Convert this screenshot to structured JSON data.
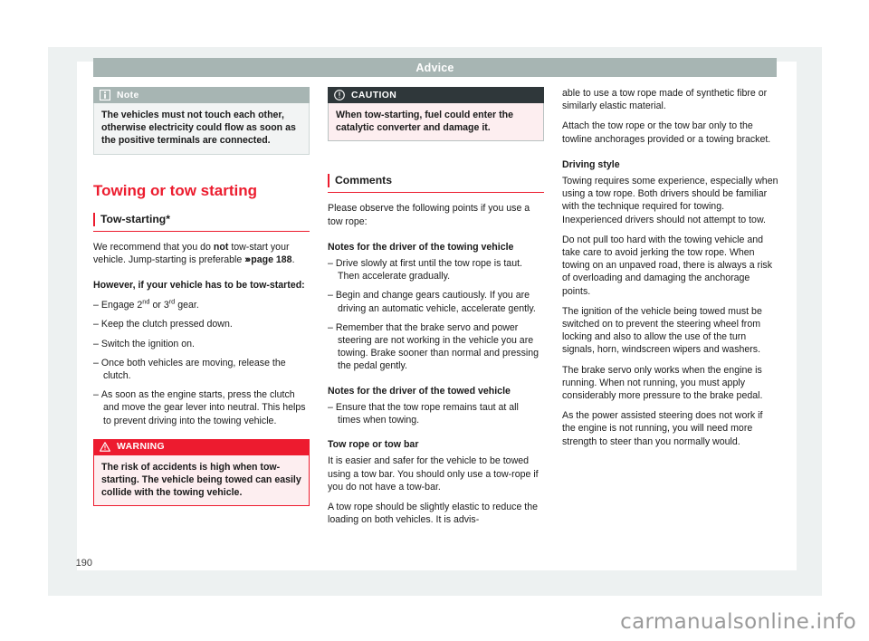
{
  "header": {
    "title": "Advice"
  },
  "folio": {
    "page_number": "190"
  },
  "watermark": {
    "text": "carmanualsonline.info"
  },
  "column_left": {
    "note_box": {
      "icon": "info-icon",
      "label": "Note",
      "text": "The vehicles must not touch each other, otherwise electricity could flow as soon as the positive terminals are connected."
    },
    "heading": "Towing or tow starting",
    "subheading": "Tow-starting*",
    "para_1_pre": "We recommend that you do ",
    "para_1_bold": "not",
    "para_1_post": " tow-start your vehicle. Jump-starting is preferable ",
    "para_1_ref_arrow": "›››",
    "para_1_ref": "page 188",
    "para_1_end": ".",
    "para_2": "However, if your vehicle has to be tow-started:",
    "list": [
      {
        "pre": "Engage 2",
        "sup1": "nd",
        "mid": " or 3",
        "sup2": "rd",
        "post": " gear."
      },
      {
        "pre": "Keep the clutch pressed down."
      },
      {
        "pre": "Switch the ignition on."
      },
      {
        "pre": "Once both vehicles are moving, release the clutch."
      },
      {
        "pre": "As soon as the engine starts, press the clutch and move the gear lever into neutral. This helps to prevent driving into the towing vehicle."
      }
    ],
    "warning_box": {
      "icon": "warning-triangle-icon",
      "label": "WARNING",
      "text": "The risk of accidents is high when tow-starting. The vehicle being towed can easily collide with the towing vehicle."
    }
  },
  "column_middle": {
    "caution_box": {
      "icon": "exclamation-circle-icon",
      "label": "CAUTION",
      "text": "When tow-starting, fuel could enter the catalytic converter and damage it."
    },
    "subheading": "Comments",
    "para_1": "Please observe the following points if you use a tow rope:",
    "heading_towing": "Notes for the driver of the towing vehicle",
    "list_towing": [
      "Drive slowly at first until the tow rope is taut. Then accelerate gradually.",
      "Begin and change gears cautiously. If you are driving an automatic vehicle, accelerate gently.",
      "Remember that the brake servo and power steering are not working in the vehicle you are towing. Brake sooner than normal and pressing the pedal gently."
    ],
    "heading_towed": "Notes for the driver of the towed vehicle",
    "list_towed": [
      "Ensure that the tow rope remains taut at all times when towing."
    ],
    "heading_rope": "Tow rope or tow bar",
    "para_rope_1": "It is easier and safer for the vehicle to be towed using a tow bar. You should only use a tow-rope if you do not have a tow-bar.",
    "para_rope_2": "A tow rope should be slightly elastic to reduce the loading on both vehicles. It is advis-"
  },
  "column_right": {
    "para_1": "able to use a tow rope made of synthetic fibre or similarly elastic material.",
    "para_2": "Attach the tow rope or the tow bar only to the towline anchorages provided or a towing bracket.",
    "heading_driving_style": "Driving style",
    "para_3": "Towing requires some experience, especially when using a tow rope. Both drivers should be familiar with the technique required for towing. Inexperienced drivers should not attempt to tow.",
    "para_4": "Do not pull too hard with the towing vehicle and take care to avoid jerking the tow rope. When towing on an unpaved road, there is always a risk of overloading and damaging the anchorage points.",
    "para_5": "The ignition of the vehicle being towed must be switched on to prevent the steering wheel from locking and also to allow the use of the turn signals, horn, windscreen wipers and washers.",
    "para_6": "The brake servo only works when the engine is running. When not running, you must apply considerably more pressure to the brake pedal.",
    "para_7": "As the power assisted steering does not work if the engine is not running, you will need more strength to steer than you normally would."
  },
  "colors": {
    "accent_red": "#ec1c2e",
    "header_gray": "#a7b5b3",
    "page_bg": "#edf1f1",
    "caution_dark": "#2f373a"
  }
}
